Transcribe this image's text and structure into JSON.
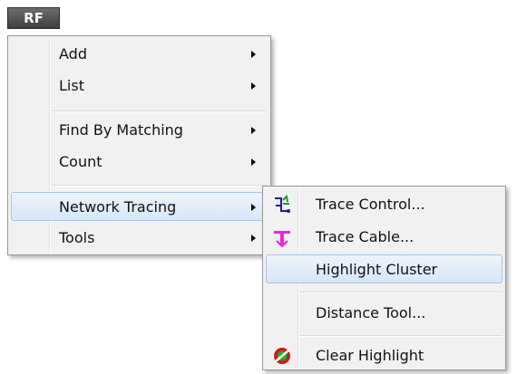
{
  "toolbar": {
    "rf_label": "RF"
  },
  "main_menu": {
    "items": [
      {
        "label": "Add",
        "has_submenu": true
      },
      {
        "label": "List",
        "has_submenu": true
      },
      {
        "label": "Find By Matching",
        "has_submenu": true
      },
      {
        "label": "Count",
        "has_submenu": true
      },
      {
        "label": "Network Tracing",
        "has_submenu": true,
        "state": "open"
      },
      {
        "label": "Tools",
        "has_submenu": true
      }
    ]
  },
  "submenu": {
    "items": [
      {
        "label": "Trace Control...",
        "icon": "trace-control-icon"
      },
      {
        "label": "Trace Cable...",
        "icon": "trace-cable-icon"
      },
      {
        "label": "Highlight Cluster",
        "icon": "",
        "state": "highlighted"
      },
      {
        "label": "Distance Tool...",
        "icon": ""
      },
      {
        "label": "Clear Highlight",
        "icon": "clear-highlight-icon"
      }
    ]
  },
  "colors": {
    "highlight_border": "#a7c3e6",
    "highlight_fill": "#dce9f8",
    "menu_background": "#f1f1f1",
    "rf_button": "#555555"
  }
}
